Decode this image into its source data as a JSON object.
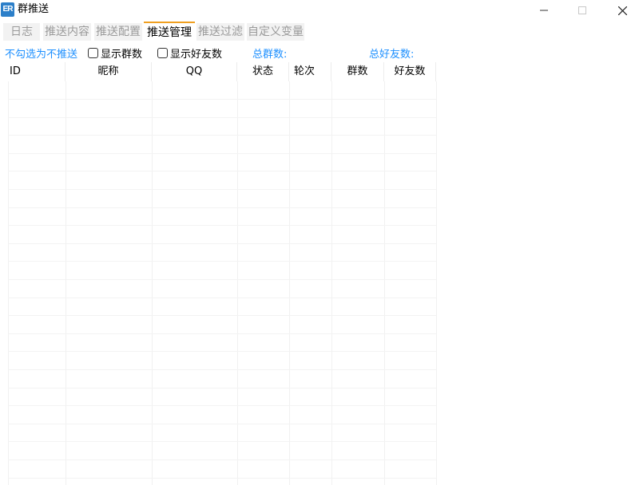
{
  "window": {
    "title": "群推送",
    "icon_text": "ER"
  },
  "tabs": [
    {
      "label": "日志",
      "active": false
    },
    {
      "label": "推送内容",
      "active": false
    },
    {
      "label": "推送配置",
      "active": false
    },
    {
      "label": "推送管理",
      "active": true
    },
    {
      "label": "推送过滤",
      "active": false
    },
    {
      "label": "自定义变量",
      "active": false
    }
  ],
  "toolbar": {
    "uncheck_hint": "不勾选为不推送",
    "show_groups_label": "显示群数",
    "show_friends_label": "显示好友数",
    "total_groups_label": "总群数:",
    "total_friends_label": "总好友数:"
  },
  "table": {
    "columns": [
      "ID",
      "昵称",
      "QQ",
      "状态",
      "轮次",
      "群数",
      "好友数"
    ],
    "rows": []
  },
  "colors": {
    "accent_blue": "#1e90ff",
    "active_tab_indicator": "#f0a020",
    "app_icon": "#2c7fc9"
  }
}
